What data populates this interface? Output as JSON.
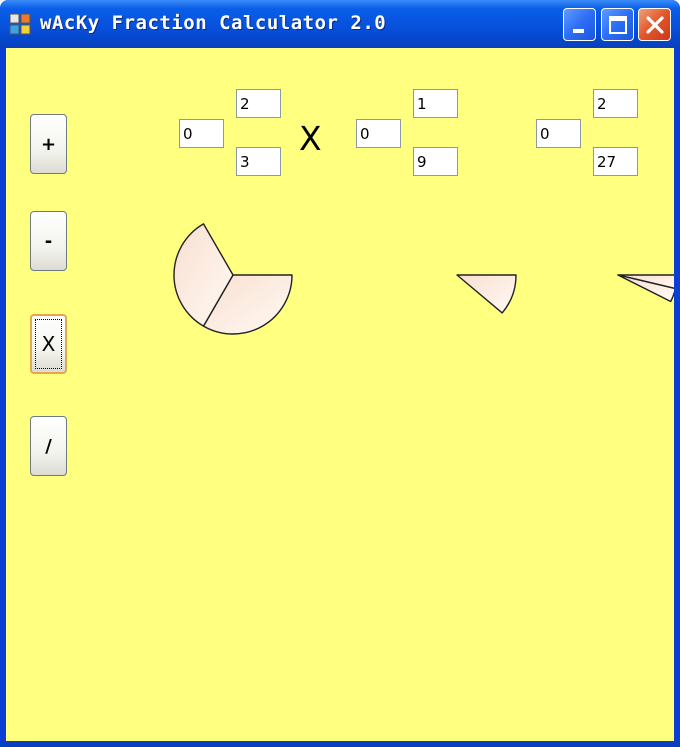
{
  "window": {
    "title": "wAcKy Fraction Calculator 2.0",
    "client_color": "#ffff80"
  },
  "operations": {
    "add_label": "+",
    "subtract_label": "-",
    "multiply_label": "X",
    "divide_label": "/",
    "selected": "multiply"
  },
  "current_operator": "X",
  "fractions": [
    {
      "whole": "0",
      "numerator": "2",
      "denominator": "3"
    },
    {
      "whole": "0",
      "numerator": "1",
      "denominator": "9"
    },
    {
      "whole": "0",
      "numerator": "2",
      "denominator": "27"
    }
  ],
  "pie_fill": [
    "#f9dfd0",
    "#fffaf4"
  ],
  "icons": {
    "app": "app-icon",
    "minimize": "minimize-icon",
    "maximize": "maximize-icon",
    "close": "close-icon"
  }
}
